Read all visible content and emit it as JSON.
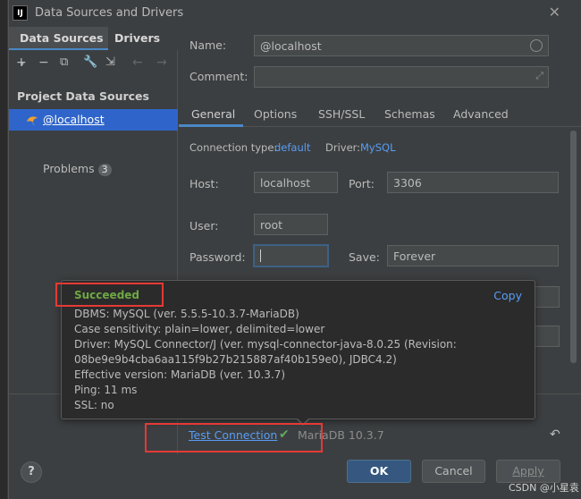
{
  "window": {
    "title": "Data Sources and Drivers"
  },
  "left": {
    "tabs": [
      "Data Sources",
      "Drivers"
    ],
    "section_title": "Project Data Sources",
    "item_label": "@localhost",
    "problems_label": "Problems",
    "problems_count": "3"
  },
  "form": {
    "name_label": "Name:",
    "name_value": "@localhost",
    "comment_label": "Comment:",
    "tabs": [
      "General",
      "Options",
      "SSH/SSL",
      "Schemas",
      "Advanced"
    ],
    "conn_type_label": "Connection type:",
    "conn_type_value": "default",
    "driver_label": "Driver:",
    "driver_value": "MySQL",
    "host_label": "Host:",
    "host_value": "localhost",
    "port_label": "Port:",
    "port_value": "3306",
    "user_label": "User:",
    "user_value": "root",
    "password_label": "Password:",
    "save_label": "Save:",
    "save_value": "Forever"
  },
  "popup": {
    "status": "Succeeded",
    "copy_label": "Copy",
    "lines": [
      "DBMS: MySQL (ver. 5.5.5-10.3.7-MariaDB)",
      "Case sensitivity: plain=lower, delimited=lower",
      "Driver: MySQL Connector/J (ver. mysql-connector-java-8.0.25 (Revision:",
      "08be9e9b4cba6aa115f9b27b215887af40b159e0), JDBC4.2)",
      "Effective version: MariaDB (ver. 10.3.7)",
      "Ping: 11 ms",
      "SSL: no"
    ]
  },
  "test": {
    "link": "Test Connection",
    "result": "MariaDB 10.3.7"
  },
  "footer": {
    "help": "?",
    "ok": "OK",
    "cancel": "Cancel",
    "apply": "Apply"
  },
  "watermark": "CSDN @小星袁",
  "colors": {
    "accent": "#589df6",
    "success": "#6ea843",
    "selection": "#2f65ca",
    "highlight": "#e53935"
  }
}
